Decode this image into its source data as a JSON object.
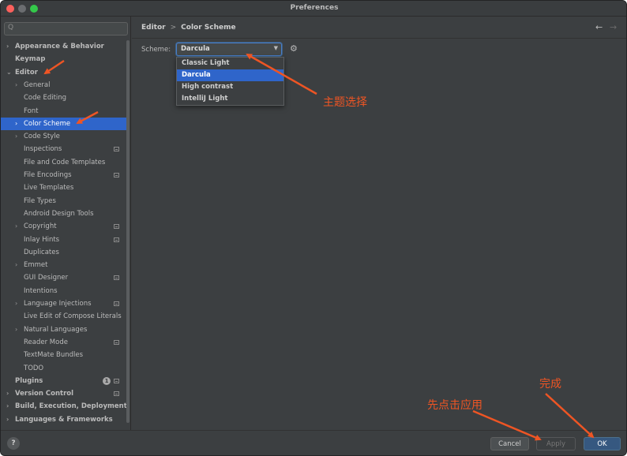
{
  "window": {
    "title": "Preferences"
  },
  "sidebar": {
    "search_placeholder": "Q",
    "items": [
      {
        "label": "Appearance & Behavior",
        "bold": true,
        "chevron": ">",
        "level": 0
      },
      {
        "label": "Keymap",
        "bold": true,
        "chevron": "",
        "level": 0
      },
      {
        "label": "Editor",
        "bold": true,
        "chevron": "v",
        "level": 0
      },
      {
        "label": "General",
        "chevron": ">",
        "level": 1
      },
      {
        "label": "Code Editing",
        "chevron": "",
        "level": 1
      },
      {
        "label": "Font",
        "chevron": "",
        "level": 1
      },
      {
        "label": "Color Scheme",
        "chevron": ">",
        "level": 1,
        "selected": true
      },
      {
        "label": "Code Style",
        "chevron": ">",
        "level": 1
      },
      {
        "label": "Inspections",
        "chevron": "",
        "level": 1,
        "project_icon": true
      },
      {
        "label": "File and Code Templates",
        "chevron": "",
        "level": 1
      },
      {
        "label": "File Encodings",
        "chevron": "",
        "level": 1,
        "project_icon": true
      },
      {
        "label": "Live Templates",
        "chevron": "",
        "level": 1
      },
      {
        "label": "File Types",
        "chevron": "",
        "level": 1
      },
      {
        "label": "Android Design Tools",
        "chevron": "",
        "level": 1
      },
      {
        "label": "Copyright",
        "chevron": ">",
        "level": 1,
        "project_icon": true
      },
      {
        "label": "Inlay Hints",
        "chevron": "",
        "level": 1,
        "project_icon": true
      },
      {
        "label": "Duplicates",
        "chevron": "",
        "level": 1
      },
      {
        "label": "Emmet",
        "chevron": ">",
        "level": 1
      },
      {
        "label": "GUI Designer",
        "chevron": "",
        "level": 1,
        "project_icon": true
      },
      {
        "label": "Intentions",
        "chevron": "",
        "level": 1
      },
      {
        "label": "Language Injections",
        "chevron": ">",
        "level": 1,
        "project_icon": true
      },
      {
        "label": "Live Edit of Compose Literals",
        "chevron": "",
        "level": 1
      },
      {
        "label": "Natural Languages",
        "chevron": ">",
        "level": 1
      },
      {
        "label": "Reader Mode",
        "chevron": "",
        "level": 1,
        "project_icon": true
      },
      {
        "label": "TextMate Bundles",
        "chevron": "",
        "level": 1
      },
      {
        "label": "TODO",
        "chevron": "",
        "level": 1
      },
      {
        "label": "Plugins",
        "bold": true,
        "chevron": "",
        "level": 0,
        "badge": "1",
        "project_icon": true
      },
      {
        "label": "Version Control",
        "bold": true,
        "chevron": ">",
        "level": 0,
        "project_icon": true
      },
      {
        "label": "Build, Execution, Deployment",
        "bold": true,
        "chevron": ">",
        "level": 0
      },
      {
        "label": "Languages & Frameworks",
        "bold": true,
        "chevron": ">",
        "level": 0
      }
    ]
  },
  "main": {
    "breadcrumb": [
      "Editor",
      "Color Scheme"
    ],
    "breadcrumb_sep": ">",
    "nav_back": "←",
    "nav_forward": "→",
    "scheme_label": "Scheme:",
    "scheme_value": "Darcula",
    "scheme_options": [
      {
        "label": "Classic Light",
        "selected": false
      },
      {
        "label": "Darcula",
        "selected": true
      },
      {
        "label": "High contrast",
        "selected": false
      },
      {
        "label": "IntelliJ Light",
        "selected": false
      }
    ]
  },
  "footer": {
    "help": "?",
    "cancel": "Cancel",
    "apply": "Apply",
    "ok": "OK"
  },
  "annotations": {
    "theme_select": "主题选择",
    "apply_first": "先点击应用",
    "done": "完成",
    "color": "#ee5524"
  },
  "colors": {
    "background": "#3c3f41",
    "selection": "#2f65ca",
    "text": "#bbbbbb",
    "ok_button": "#365880"
  },
  "icons": [
    "search-icon",
    "chevron-right-icon",
    "chevron-down-icon",
    "project-scope-icon",
    "gear-icon",
    "arrow-left-icon",
    "arrow-right-icon",
    "help-icon",
    "dropdown-arrow-icon"
  ]
}
